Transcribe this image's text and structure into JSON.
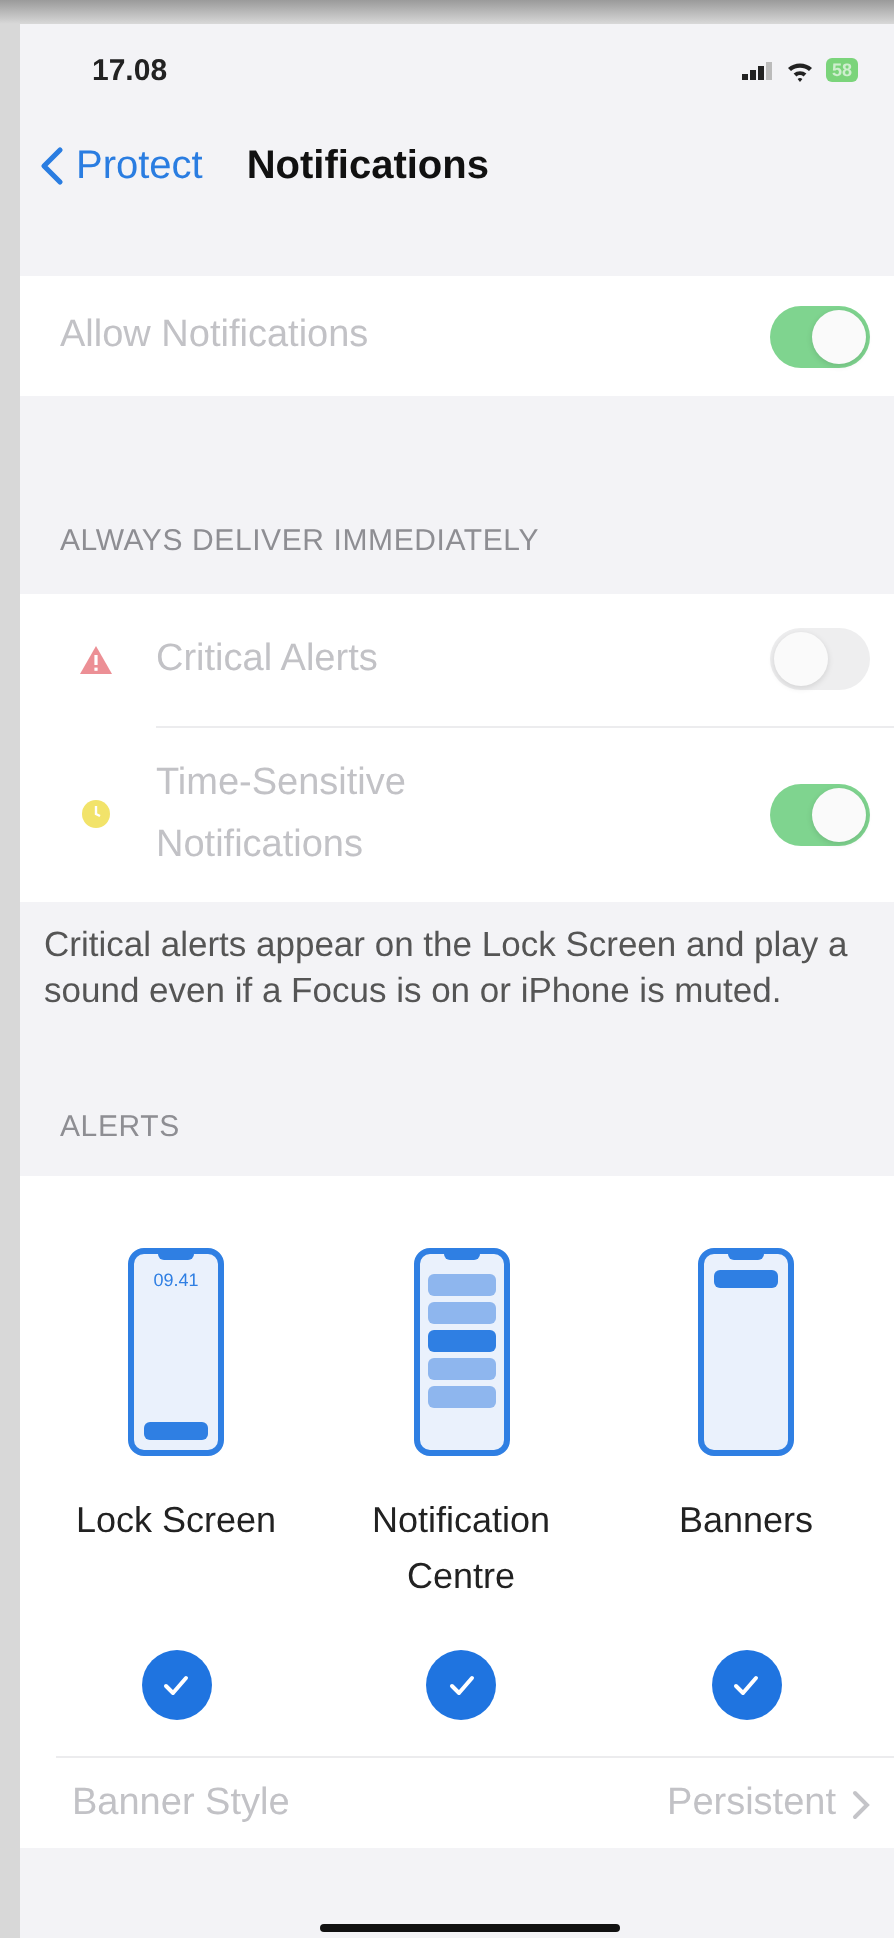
{
  "status_bar": {
    "time": "17.08",
    "battery": "58"
  },
  "nav": {
    "back": "Protect",
    "title": "Notifications"
  },
  "main_toggle": {
    "label": "Allow Notifications",
    "on": true,
    "disabled": true
  },
  "deliver_section": {
    "header": "ALWAYS DELIVER IMMEDIATELY",
    "rows": [
      {
        "kind": "critical",
        "label": "Critical Alerts",
        "on": false,
        "disabled": true
      },
      {
        "kind": "time",
        "label": "Time-Sensitive Notifications",
        "on": true,
        "disabled": true
      }
    ],
    "footer": "Critical alerts appear on the Lock Screen and play a sound even if a Focus is on or iPhone is muted."
  },
  "alerts_section": {
    "header": "ALERTS",
    "options": [
      {
        "kind": "lock",
        "label": "Lock Screen",
        "clock": "09.41",
        "checked": true
      },
      {
        "kind": "centre",
        "label": "Notification Centre",
        "checked": true
      },
      {
        "kind": "banners",
        "label": "Banners",
        "checked": true
      }
    ],
    "banner_style": {
      "label": "Banner Style",
      "value": "Persistent",
      "disabled": true
    }
  }
}
